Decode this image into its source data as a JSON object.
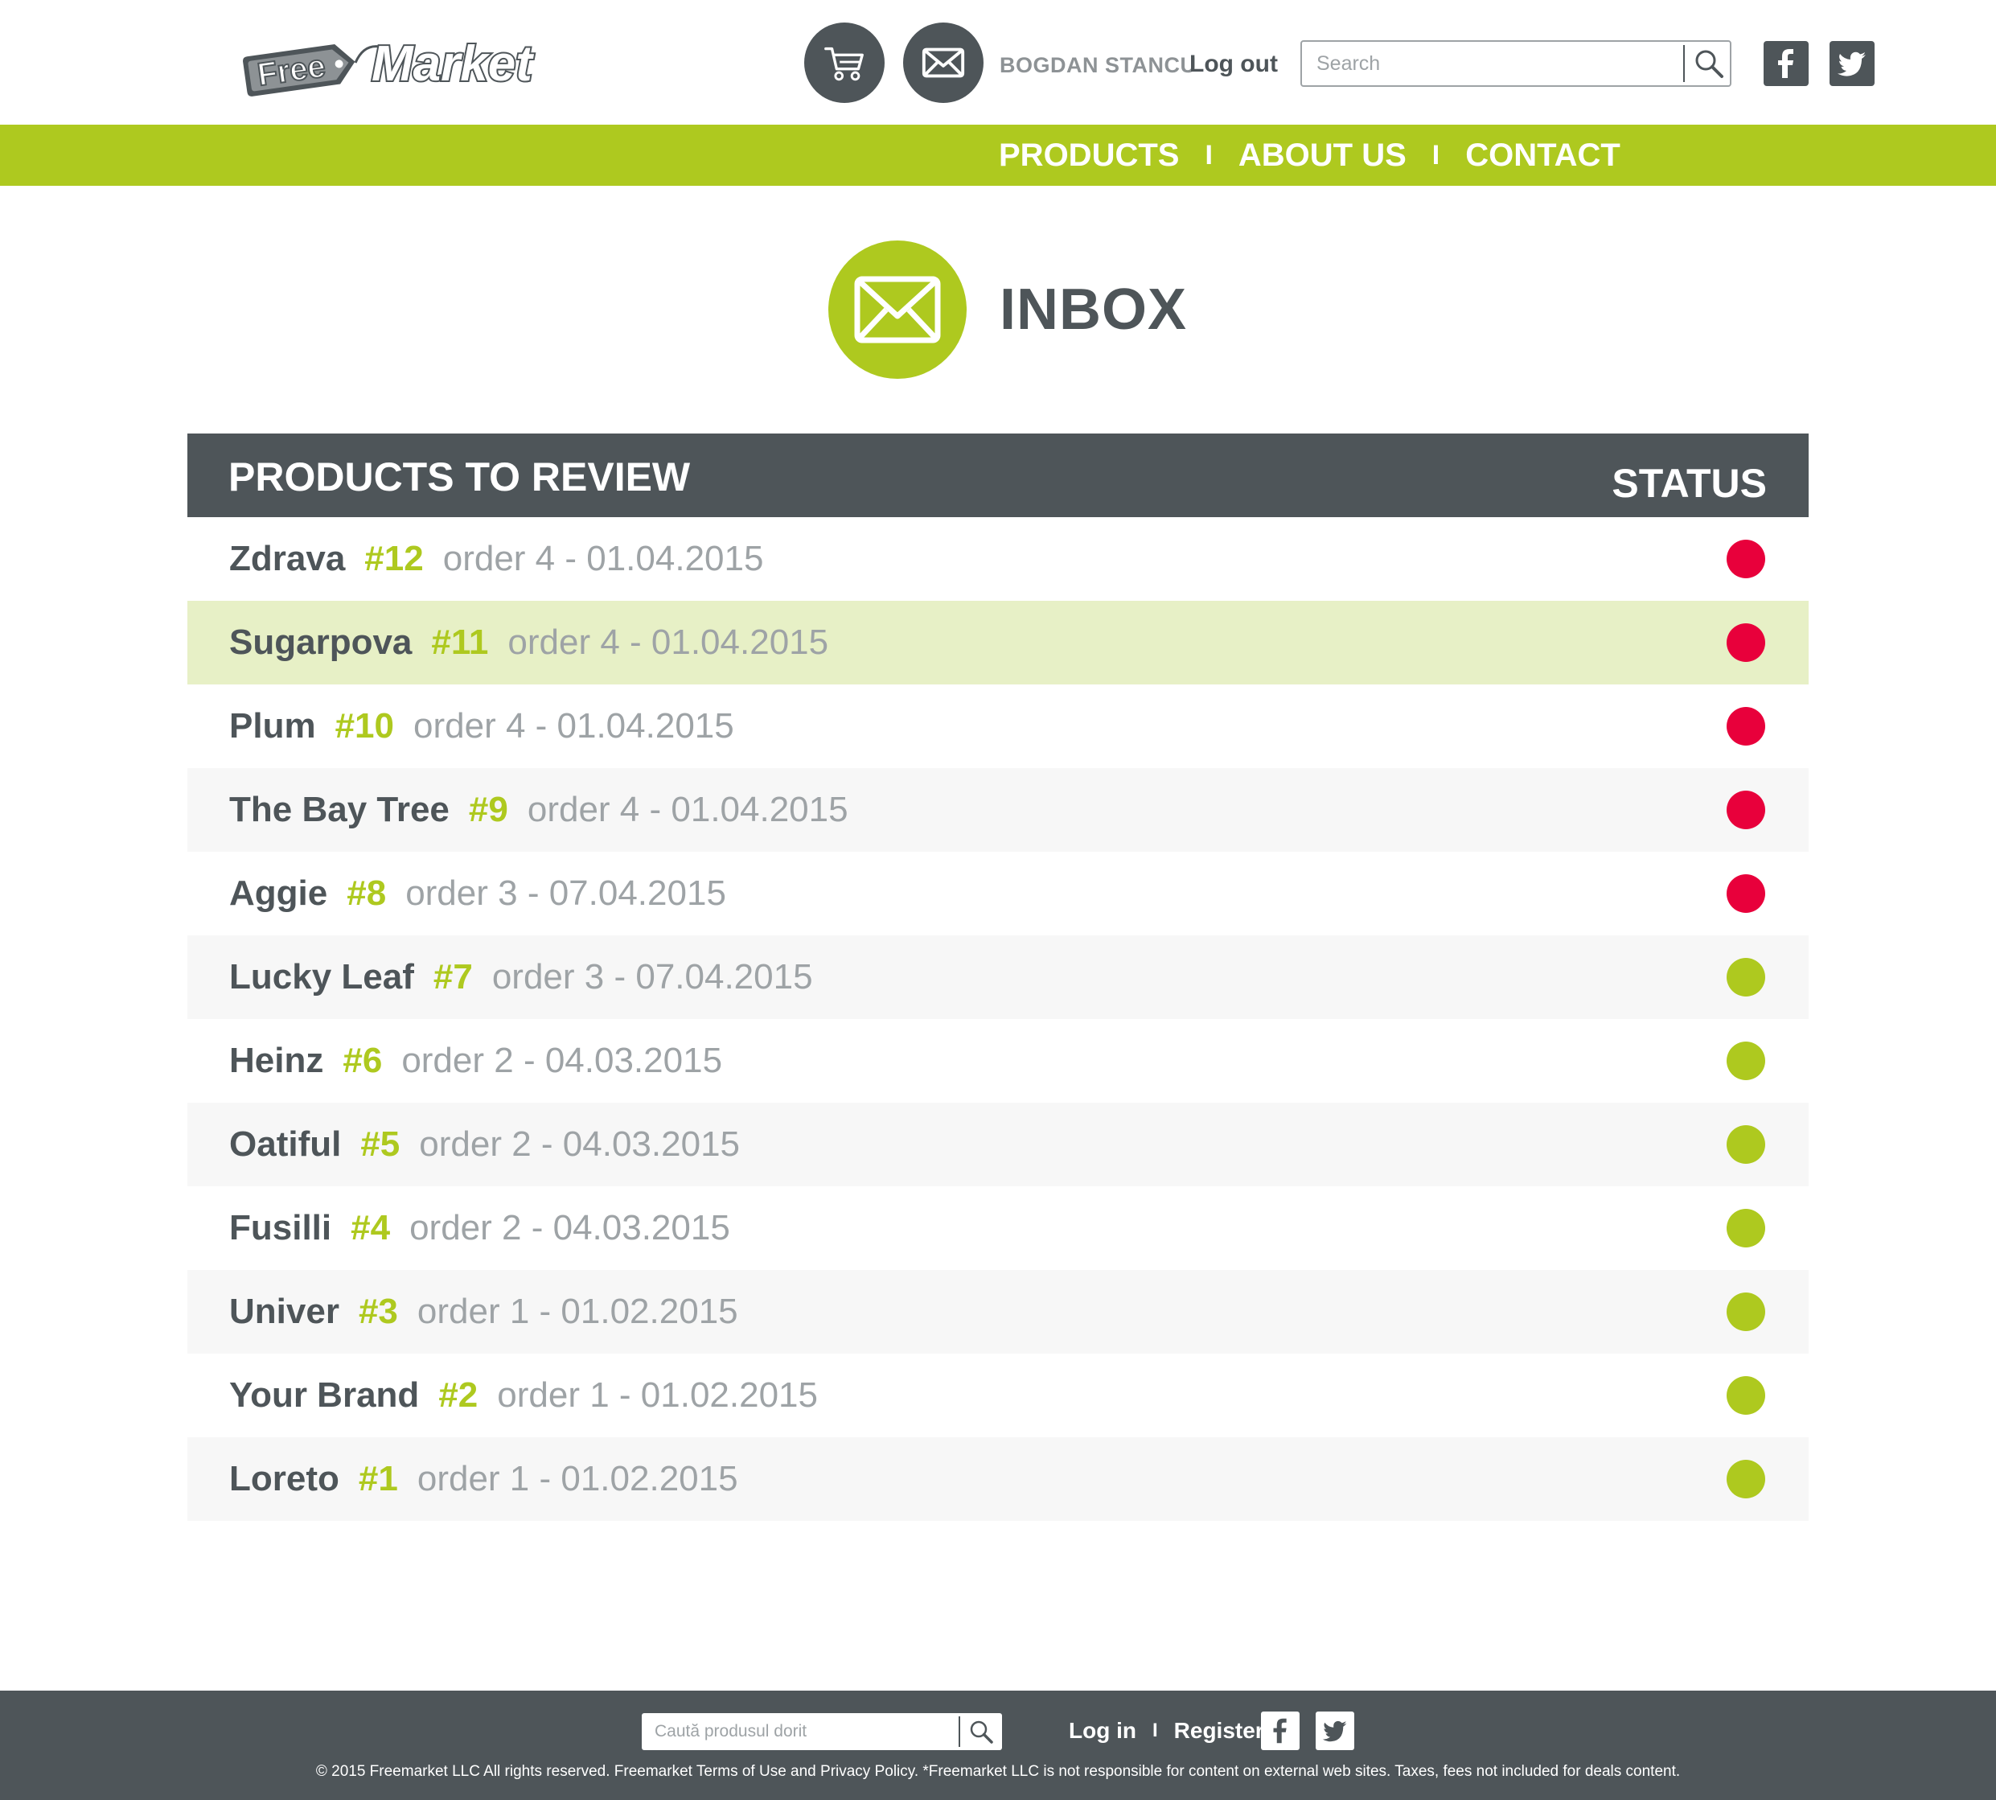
{
  "brand": {
    "logo_free": "Free",
    "logo_market": "Market"
  },
  "header": {
    "username": "BOGDAN STANCU",
    "logout_label": "Log out",
    "search_placeholder": "Search"
  },
  "nav": {
    "items": [
      {
        "label": "PRODUCTS"
      },
      {
        "label": "ABOUT US"
      },
      {
        "label": "CONTACT"
      }
    ],
    "separator": "I"
  },
  "page": {
    "title": "INBOX"
  },
  "table": {
    "header_left": "PRODUCTS TO REVIEW",
    "header_right": "STATUS",
    "rows": [
      {
        "name": "Zdrava",
        "num": "#12",
        "order": "order 4 - 01.04.2015",
        "status": "pending"
      },
      {
        "name": "Sugarpova",
        "num": "#11",
        "order": "order 4 - 01.04.2015",
        "status": "pending"
      },
      {
        "name": "Plum",
        "num": "#10",
        "order": "order 4 - 01.04.2015",
        "status": "pending"
      },
      {
        "name": "The Bay Tree",
        "num": "#9",
        "order": "order 4 - 01.04.2015",
        "status": "pending"
      },
      {
        "name": "Aggie",
        "num": "#8",
        "order": "order 3 - 07.04.2015",
        "status": "pending"
      },
      {
        "name": "Lucky Leaf",
        "num": "#7",
        "order": "order 3 - 07.04.2015",
        "status": "done"
      },
      {
        "name": "Heinz",
        "num": "#6",
        "order": "order 2 - 04.03.2015",
        "status": "done"
      },
      {
        "name": "Oatiful",
        "num": "#5",
        "order": "order 2 - 04.03.2015",
        "status": "done"
      },
      {
        "name": "Fusilli",
        "num": "#4",
        "order": "order 2 - 04.03.2015",
        "status": "done"
      },
      {
        "name": "Univer",
        "num": "#3",
        "order": "order 1 - 01.02.2015",
        "status": "done"
      },
      {
        "name": "Your Brand",
        "num": "#2",
        "order": "order 1 - 01.02.2015",
        "status": "done"
      },
      {
        "name": "Loreto",
        "num": "#1",
        "order": "order 1 - 01.02.2015",
        "status": "done"
      }
    ]
  },
  "footer": {
    "search_placeholder": "Caută produsul dorit",
    "login_label": "Log in",
    "separator": "I",
    "register_label": "Register",
    "copyright": "© 2015 Freemarket LLC All rights reserved. Freemarket Terms of Use and Privacy Policy. *Freemarket LLC is not responsible for content on external web sites. Taxes, fees not included for deals content."
  },
  "colors": {
    "accent": "#aec91f",
    "dark": "#4e5559",
    "status_pending": "#e8003b",
    "status_done": "#aec91f",
    "selected_row": "#e7f0c6"
  },
  "icons": [
    "cart-icon",
    "mail-icon",
    "search-icon",
    "facebook-icon",
    "twitter-icon"
  ]
}
